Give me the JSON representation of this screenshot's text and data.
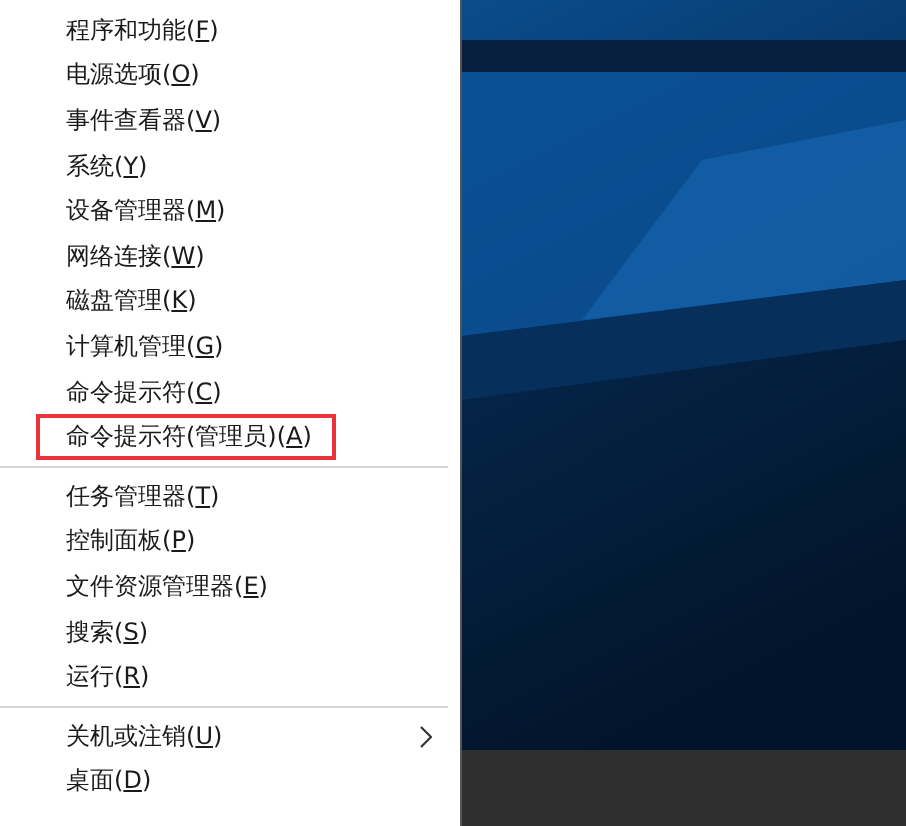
{
  "menu": {
    "groups": [
      {
        "items": [
          {
            "label": "程序和功能(",
            "key": "F",
            "end": ")",
            "highlighted": false,
            "submenu": false
          },
          {
            "label": "电源选项(",
            "key": "O",
            "end": ")",
            "highlighted": false,
            "submenu": false
          },
          {
            "label": "事件查看器(",
            "key": "V",
            "end": ")",
            "highlighted": false,
            "submenu": false
          },
          {
            "label": "系统(",
            "key": "Y",
            "end": ")",
            "highlighted": false,
            "submenu": false
          },
          {
            "label": "设备管理器(",
            "key": "M",
            "end": ")",
            "highlighted": false,
            "submenu": false
          },
          {
            "label": "网络连接(",
            "key": "W",
            "end": ")",
            "highlighted": false,
            "submenu": false
          },
          {
            "label": "磁盘管理(",
            "key": "K",
            "end": ")",
            "highlighted": false,
            "submenu": false
          },
          {
            "label": "计算机管理(",
            "key": "G",
            "end": ")",
            "highlighted": false,
            "submenu": false
          },
          {
            "label": "命令提示符(",
            "key": "C",
            "end": ")",
            "highlighted": false,
            "submenu": false
          },
          {
            "label": "命令提示符(管理员)(",
            "key": "A",
            "end": ")",
            "highlighted": true,
            "submenu": false
          }
        ]
      },
      {
        "items": [
          {
            "label": "任务管理器(",
            "key": "T",
            "end": ")",
            "highlighted": false,
            "submenu": false
          },
          {
            "label": "控制面板(",
            "key": "P",
            "end": ")",
            "highlighted": false,
            "submenu": false
          },
          {
            "label": "文件资源管理器(",
            "key": "E",
            "end": ")",
            "highlighted": false,
            "submenu": false
          },
          {
            "label": "搜索(",
            "key": "S",
            "end": ")",
            "highlighted": false,
            "submenu": false
          },
          {
            "label": "运行(",
            "key": "R",
            "end": ")",
            "highlighted": false,
            "submenu": false
          }
        ]
      },
      {
        "items": [
          {
            "label": "关机或注销(",
            "key": "U",
            "end": ")",
            "highlighted": false,
            "submenu": true
          },
          {
            "label": "桌面(",
            "key": "D",
            "end": ")",
            "highlighted": false,
            "submenu": false
          }
        ]
      }
    ]
  }
}
